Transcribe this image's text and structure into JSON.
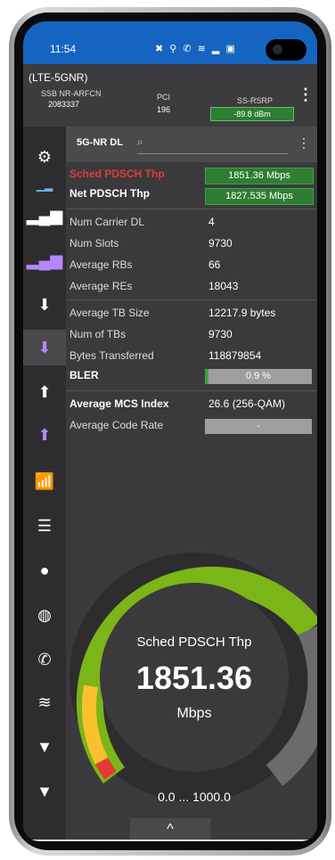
{
  "status": {
    "time": "11:54",
    "icons": "✖ ⚲ ✆ ≋ ▂ ▣"
  },
  "info": {
    "title": "(LTE-5GNR)",
    "arfcn_label": "SSB NR-ARFCN",
    "arfcn_value": "2083337",
    "pci_label": "PCI",
    "pci_value": "196",
    "rsrp_label": "SS-RSRP",
    "rsrp_value": "-89.8 dBm"
  },
  "header": {
    "label": "5G-NR DL",
    "search_icon": "search-icon"
  },
  "metrics": {
    "sched_label": "Sched PDSCH Thp",
    "sched_value": "1851.36 Mbps",
    "net_label": "Net PDSCH Thp",
    "net_value": "1827.535 Mbps",
    "num_carrier_label": "Num Carrier DL",
    "num_carrier_value": "4",
    "num_slots_label": "Num Slots",
    "num_slots_value": "9730",
    "avg_rbs_label": "Average RBs",
    "avg_rbs_value": "66",
    "avg_res_label": "Average REs",
    "avg_res_value": "18043",
    "avg_tb_label": "Average TB Size",
    "avg_tb_value": "12217.9 bytes",
    "num_tbs_label": "Num of TBs",
    "num_tbs_value": "9730",
    "bytes_label": "Bytes Transferred",
    "bytes_value": "118879854",
    "bler_label": "BLER",
    "bler_value": "0.9 %",
    "bler_fraction": 0.03,
    "mcs_label": "Average MCS Index",
    "mcs_value": "26.6 (256-QAM)",
    "code_rate_label": "Average Code Rate",
    "code_rate_value": "-"
  },
  "gauge": {
    "title": "Sched PDSCH Thp",
    "value": "1851.36",
    "unit": "Mbps",
    "range": "0.0 ... 1000.0",
    "fill_color": "#7cb518"
  },
  "bottom": {
    "chevron": "^"
  }
}
